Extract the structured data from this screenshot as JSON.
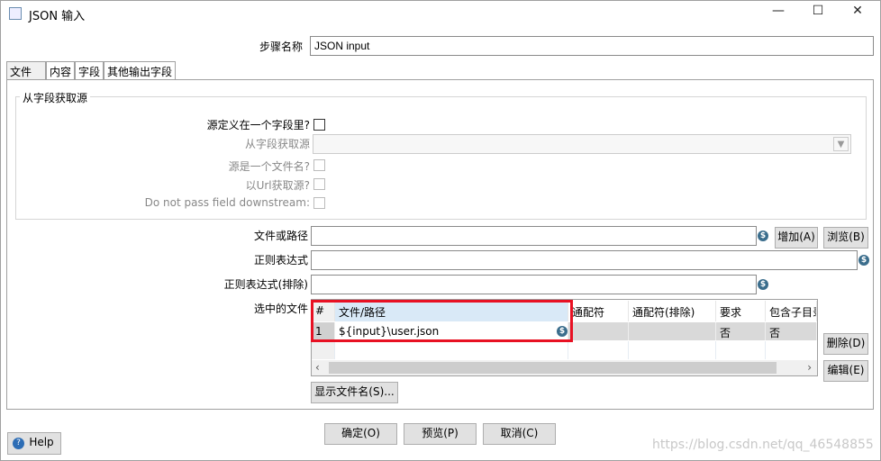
{
  "window": {
    "title": "JSON 输入",
    "icon": "json-step-icon"
  },
  "step_name": {
    "label": "步骤名称",
    "value": "JSON input"
  },
  "tabs": [
    {
      "label": "文件",
      "active": true
    },
    {
      "label": "内容"
    },
    {
      "label": "字段"
    },
    {
      "label": "其他输出字段"
    }
  ],
  "source_group": {
    "title": "从字段获取源",
    "rows": [
      {
        "label": "源定义在一个字段里?",
        "enabled": true,
        "checked": false
      },
      {
        "label": "从字段获取源",
        "type": "dropdown",
        "value": ""
      },
      {
        "label": "源是一个文件名?",
        "enabled": false,
        "checked": false
      },
      {
        "label": "以Url获取源?",
        "enabled": false,
        "checked": false
      },
      {
        "label": "Do not pass field downstream:",
        "enabled": false,
        "checked": false
      }
    ]
  },
  "file_path": {
    "label": "文件或路径",
    "value": "",
    "add": "增加(A)",
    "browse": "浏览(B)"
  },
  "regex": {
    "label": "正则表达式",
    "value": ""
  },
  "regex_exclude": {
    "label": "正则表达式(排除)",
    "value": ""
  },
  "selected_files": {
    "label": "选中的文件",
    "columns": [
      "#",
      "文件/路径",
      "通配符",
      "通配符(排除)",
      "要求",
      "包含子目录"
    ],
    "rows": [
      [
        "1",
        "${input}\\user.json",
        "",
        "",
        "否",
        "否"
      ]
    ],
    "delete": "删除(D)",
    "edit": "编辑(E)"
  },
  "show_filenames": "显示文件名(S)...",
  "footer": {
    "ok": "确定(O)",
    "preview": "预览(P)",
    "cancel": "取消(C)",
    "help": "Help"
  },
  "watermark": "https://blog.csdn.net/qq_46548855",
  "colors": {
    "highlight": "#e81123",
    "header_sel": "#d9e9f7",
    "variable_icon": "#3a6d8c"
  }
}
